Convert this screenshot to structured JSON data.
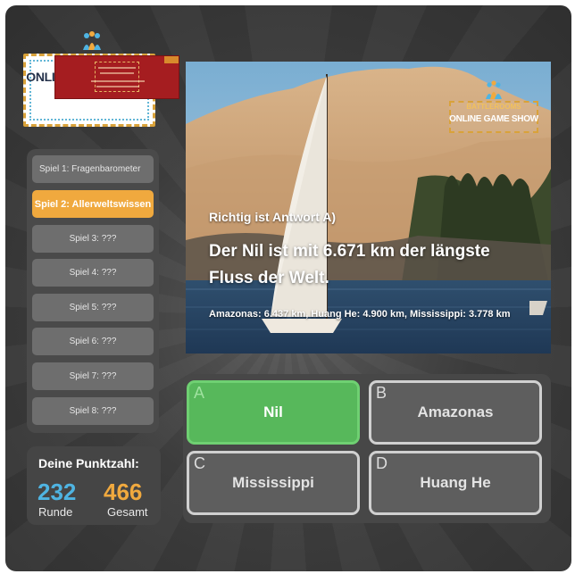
{
  "logo": {
    "title": "ONLINE GAME SHOW"
  },
  "promo": {
    "label": "promotional banner",
    "color": "#a51d20"
  },
  "sidebar": {
    "items": [
      {
        "label": "Spiel 1: Fragenbarometer",
        "active": false
      },
      {
        "label": "Spiel 2: Allerweltswissen",
        "active": true
      },
      {
        "label": "Spiel 3: ???",
        "active": false
      },
      {
        "label": "Spiel 4: ???",
        "active": false
      },
      {
        "label": "Spiel 5: ???",
        "active": false
      },
      {
        "label": "Spiel 6: ???",
        "active": false
      },
      {
        "label": "Spiel 7: ???",
        "active": false
      },
      {
        "label": "Spiel 8: ???",
        "active": false
      }
    ]
  },
  "score": {
    "title": "Deine Punktzahl:",
    "round_value": "232",
    "round_label": "Runde",
    "total_value": "466",
    "total_label": "Gesamt"
  },
  "scene": {
    "badge_line1": "BATTLEROOMS",
    "badge_line2": "ONLINE GAME SHOW",
    "answer_heading": "Richtig ist Antwort A)",
    "fact": "Der Nil ist mit 6.671 km der längste Fluss der Welt.",
    "note": "Amazonas: 6.437 km, Huang He: 4.900 km, Mississippi: 3.778 km"
  },
  "answers": [
    {
      "letter": "A",
      "text": "Nil",
      "correct": true
    },
    {
      "letter": "B",
      "text": "Amazonas",
      "correct": false
    },
    {
      "letter": "C",
      "text": "Mississippi",
      "correct": false
    },
    {
      "letter": "D",
      "text": "Huang He",
      "correct": false
    }
  ],
  "colors": {
    "accent_orange": "#f0a93e",
    "accent_blue": "#4fb4e2",
    "correct_green": "#57b85b"
  }
}
